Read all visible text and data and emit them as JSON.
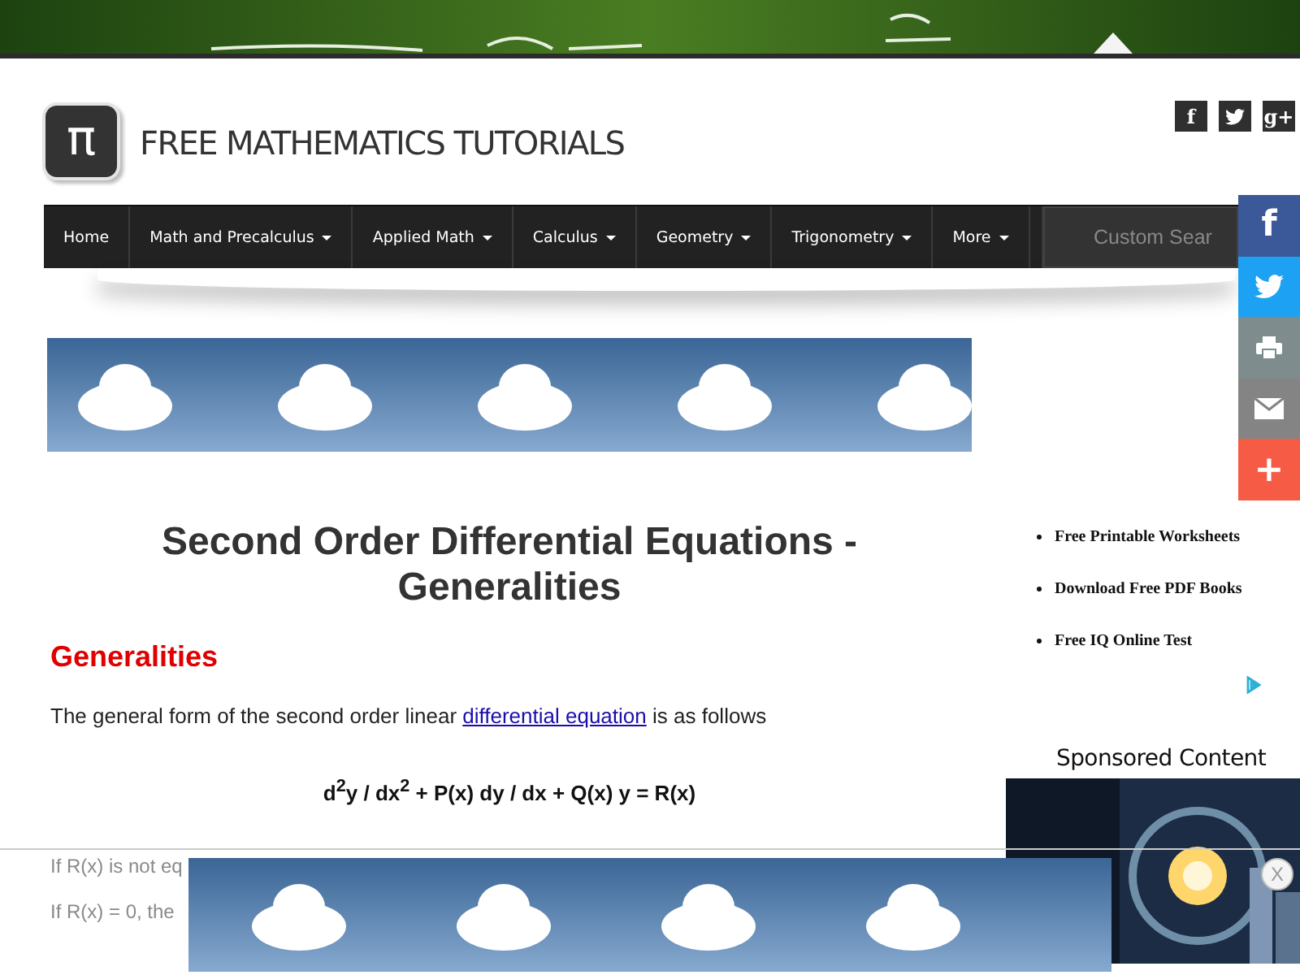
{
  "site": {
    "logo": "π",
    "title": "FREE MATHEMATICS TUTORIALS"
  },
  "social_links": [
    {
      "kind": "facebook",
      "label": "f"
    },
    {
      "kind": "twitter"
    },
    {
      "kind": "google",
      "label": "g+"
    }
  ],
  "nav": {
    "items": [
      {
        "label": "Home",
        "dropdown": false
      },
      {
        "label": "Math and Precalculus",
        "dropdown": true
      },
      {
        "label": "Applied Math",
        "dropdown": true
      },
      {
        "label": "Calculus",
        "dropdown": true
      },
      {
        "label": "Geometry",
        "dropdown": true
      },
      {
        "label": "Trigonometry",
        "dropdown": true
      },
      {
        "label": "More",
        "dropdown": true
      }
    ],
    "search": {
      "placeholder": "Custom Sear"
    }
  },
  "share_bar": [
    {
      "kind": "facebook",
      "label": "f",
      "color": "#3b5998"
    },
    {
      "kind": "twitter",
      "color": "#1da1f2"
    },
    {
      "kind": "print",
      "color": "#7f8c8d"
    },
    {
      "kind": "email",
      "color": "#848484"
    },
    {
      "kind": "more",
      "label": "+",
      "color": "#f65c45"
    }
  ],
  "article": {
    "title": "Second Order Differential Equations - Generalities",
    "section": "Generalities",
    "intro": {
      "before": "The general form of the second order linear ",
      "link": "differential equation",
      "after": " is as follows"
    },
    "equation": "d$^{2}$y / dx$^{2}$ + P(x) dy / dx + Q(x) y = R(x)",
    "faded_lines": [
      "If R(x) is not eq",
      "If R(x) = 0, the"
    ]
  },
  "sidebar": {
    "links": [
      "Free Printable Worksheets",
      "Download Free PDF Books",
      "Free IQ Online Test"
    ],
    "sponsored_title": "Sponsored Content"
  },
  "bottom_ad": {
    "close": "X"
  }
}
